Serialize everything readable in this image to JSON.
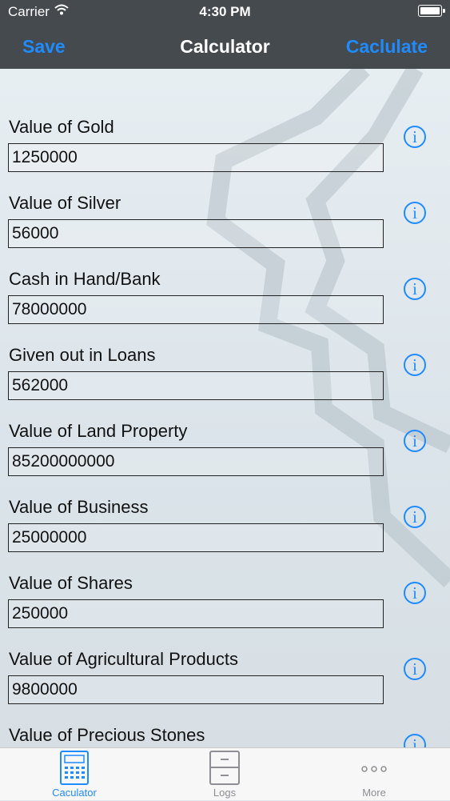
{
  "status_bar": {
    "carrier": "Carrier",
    "time": "4:30 PM"
  },
  "nav": {
    "left_button": "Save",
    "title": "Calculator",
    "right_button": "Caclulate"
  },
  "fields": [
    {
      "label": "Value of Gold",
      "value": "1250000"
    },
    {
      "label": "Value of Silver",
      "value": "56000"
    },
    {
      "label": "Cash in Hand/Bank",
      "value": "78000000"
    },
    {
      "label": "Given out in Loans",
      "value": "562000"
    },
    {
      "label": "Value of Land Property",
      "value": "85200000000"
    },
    {
      "label": "Value of Business",
      "value": "25000000"
    },
    {
      "label": "Value of Shares",
      "value": "250000"
    },
    {
      "label": "Value of Agricultural Products",
      "value": "9800000"
    },
    {
      "label": "Value of Precious Stones",
      "value": ""
    }
  ],
  "info_glyph": "i",
  "tabs": [
    {
      "label": "Caculator",
      "icon": "calculator-icon",
      "active": true
    },
    {
      "label": "Logs",
      "icon": "file-cabinet-icon",
      "active": false
    },
    {
      "label": "More",
      "icon": "more-dots-icon",
      "active": false
    }
  ],
  "colors": {
    "accent": "#1f8bff",
    "nav_background": "#454a4f",
    "tab_inactive": "#8e8e93"
  }
}
